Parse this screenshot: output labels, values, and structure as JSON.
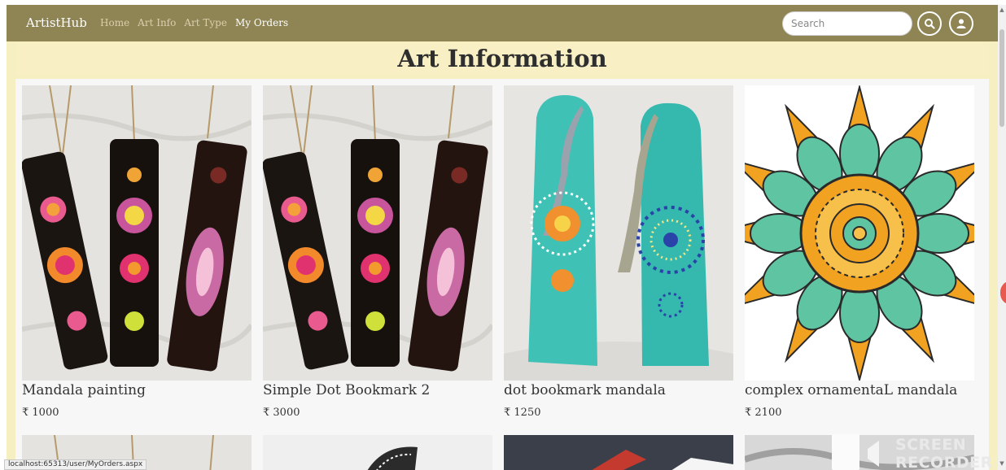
{
  "navbar": {
    "brand": "ArtistHub",
    "links": [
      {
        "label": "Home",
        "active": false
      },
      {
        "label": "Art Info",
        "active": false
      },
      {
        "label": "Art Type",
        "active": false
      },
      {
        "label": "My Orders",
        "active": true
      }
    ],
    "search_placeholder": "Search",
    "search_icon": "search-icon",
    "user_icon": "user-icon"
  },
  "page": {
    "title": "Art Information"
  },
  "products": [
    {
      "name": "Mandala painting",
      "price": "₹ 1000"
    },
    {
      "name": "Simple Dot Bookmark 2",
      "price": "₹ 3000"
    },
    {
      "name": "dot bookmark mandala",
      "price": "₹ 1250"
    },
    {
      "name": "complex ornamentaL mandala",
      "price": "₹ 2100"
    }
  ],
  "status_bar": {
    "url": "localhost:65313/user/MyOrders.aspx"
  },
  "watermark": {
    "line1": "SCREEN",
    "line2": "RECORDER"
  },
  "colors": {
    "navbar": "#8f8454",
    "page_background": "#f6efc2",
    "grid_background": "#f7f7f7"
  }
}
